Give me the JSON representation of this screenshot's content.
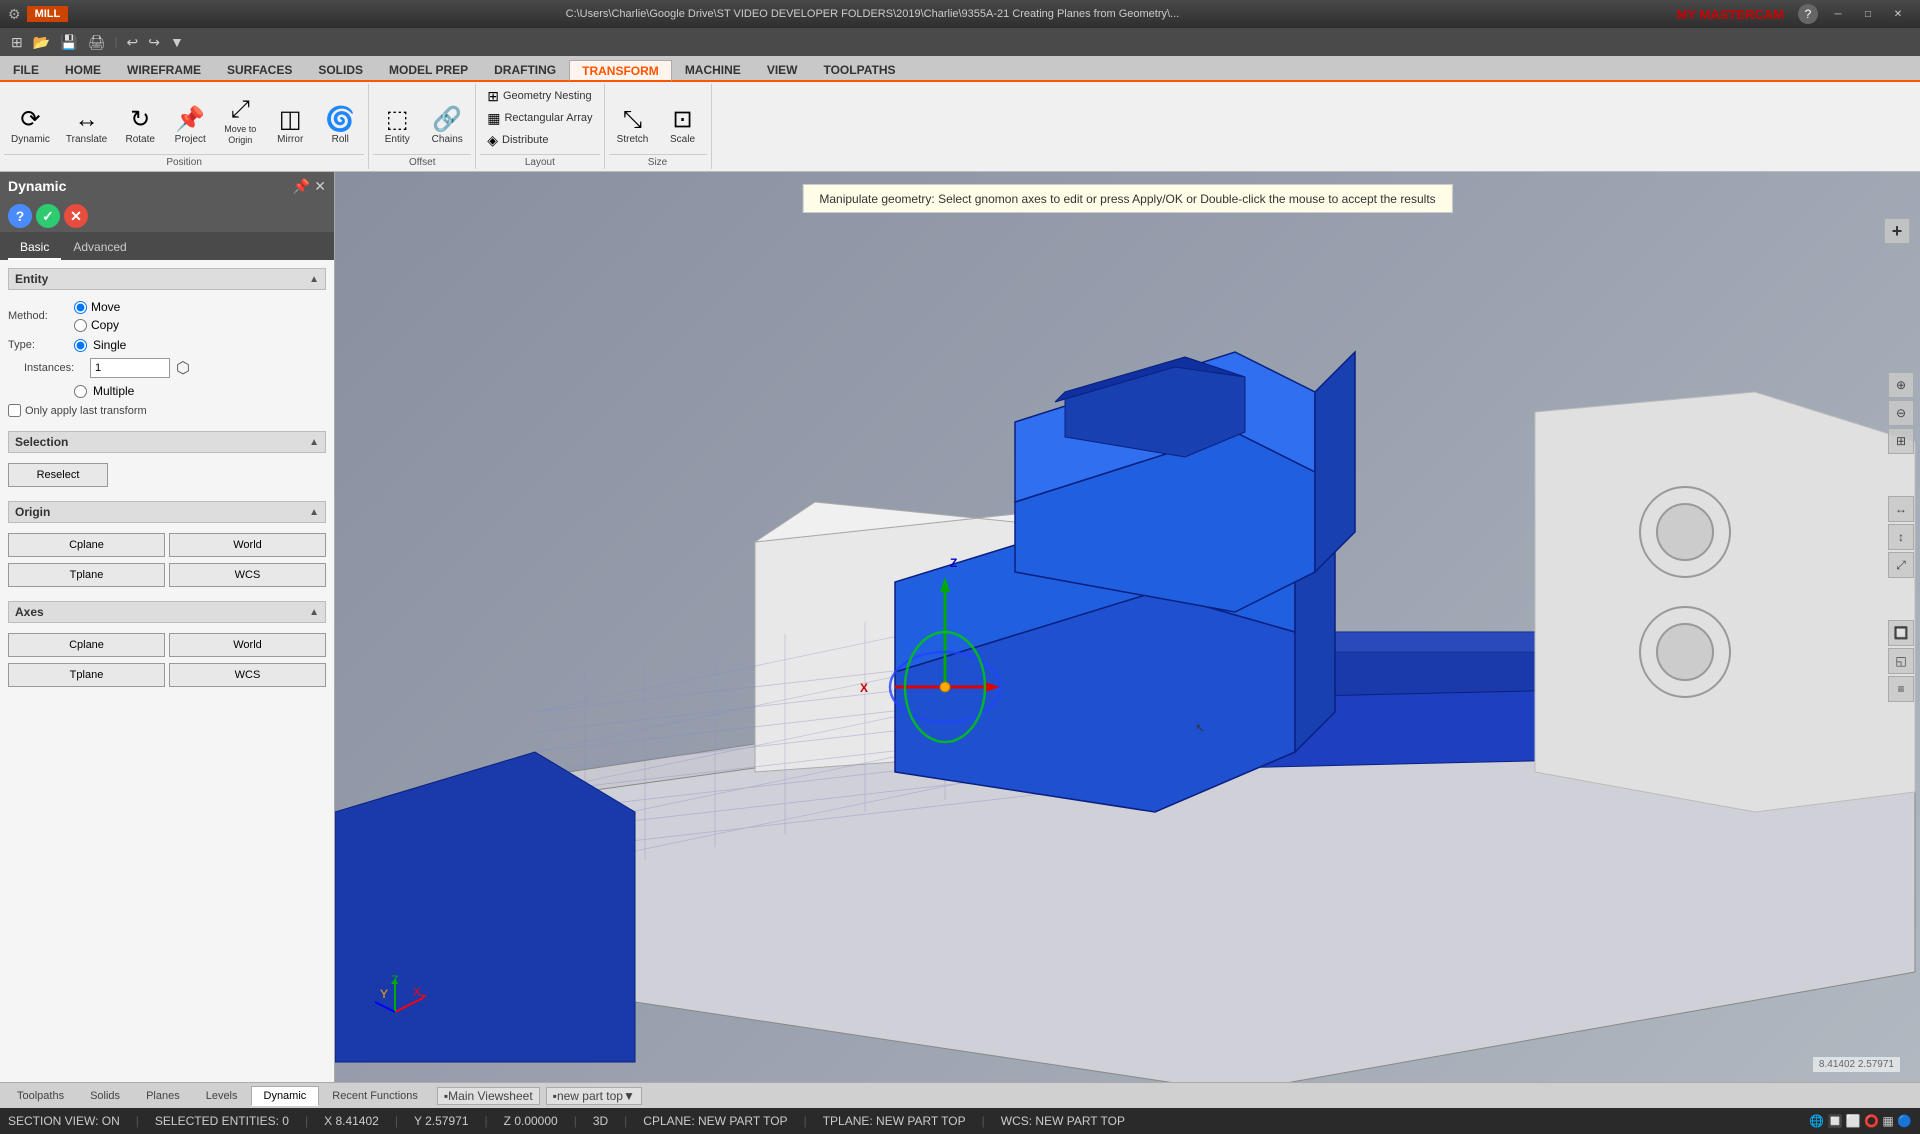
{
  "app": {
    "name": "Mastercam",
    "mill_label": "MILL",
    "title": "C:\\Users\\Charlie\\Google Drive\\ST VIDEO DEVELOPER FOLDERS\\2019\\Charlie\\9355A-21 Creating Planes from Geometry\\...",
    "branding": "MY MASTERCAM"
  },
  "quickaccess": {
    "buttons": [
      "⊞",
      "📁",
      "💾",
      "🖨",
      "↩",
      "↪",
      "▼"
    ]
  },
  "ribbon_tabs": {
    "items": [
      {
        "label": "FILE",
        "active": false
      },
      {
        "label": "HOME",
        "active": false
      },
      {
        "label": "WIREFRAME",
        "active": false
      },
      {
        "label": "SURFACES",
        "active": false
      },
      {
        "label": "SOLIDS",
        "active": false
      },
      {
        "label": "MODEL PREP",
        "active": false
      },
      {
        "label": "DRAFTING",
        "active": false
      },
      {
        "label": "TRANSFORM",
        "active": true
      },
      {
        "label": "MACHINE",
        "active": false
      },
      {
        "label": "VIEW",
        "active": false
      },
      {
        "label": "TOOLPATHS",
        "active": false
      }
    ]
  },
  "ribbon_groups": {
    "position": {
      "label": "Position",
      "buttons": [
        {
          "icon": "⟳",
          "label": "Dynamic"
        },
        {
          "icon": "↔",
          "label": "Translate"
        },
        {
          "icon": "↻",
          "label": "Rotate"
        },
        {
          "icon": "📌",
          "label": "Project"
        },
        {
          "icon": "⤢",
          "label": "Move to\nOrigin"
        },
        {
          "icon": "🔄",
          "label": "Mirror"
        },
        {
          "icon": "🌀",
          "label": "Roll"
        }
      ]
    },
    "offset": {
      "label": "Offset",
      "buttons": [
        {
          "icon": "⬚",
          "label": "Entity"
        },
        {
          "icon": "🔗",
          "label": "Chains"
        }
      ]
    },
    "layout": {
      "label": "Layout",
      "items": [
        {
          "icon": "⊞",
          "label": "Geometry Nesting"
        },
        {
          "icon": "▦",
          "label": "Rectangular Array"
        },
        {
          "icon": "◈",
          "label": "Distribute"
        }
      ]
    },
    "size": {
      "label": "Size",
      "buttons": [
        {
          "icon": "⤡",
          "label": "Stretch"
        },
        {
          "icon": "⊡",
          "label": "Scale"
        }
      ]
    }
  },
  "panel": {
    "title": "Dynamic",
    "pin_icon": "📌",
    "close_icon": "✕",
    "action_buttons": [
      {
        "icon": "?",
        "type": "blue"
      },
      {
        "icon": "✓",
        "type": "green"
      },
      {
        "icon": "✕",
        "type": "red"
      }
    ],
    "tabs": [
      {
        "label": "Basic",
        "active": true
      },
      {
        "label": "Advanced",
        "active": false
      }
    ],
    "sections": {
      "entity": {
        "title": "Entity",
        "method_label": "Method:",
        "method_options": [
          {
            "label": "Move",
            "value": "move",
            "checked": true
          },
          {
            "label": "Copy",
            "value": "copy",
            "checked": false
          }
        ],
        "type_label": "Type:",
        "type_single_label": "Single",
        "type_single_checked": true,
        "instances_label": "Instances:",
        "instances_value": "1",
        "type_multiple_label": "Multiple",
        "type_multiple_checked": false,
        "checkbox_label": "Only apply last transform",
        "checkbox_checked": false
      },
      "selection": {
        "title": "Selection",
        "reselect_label": "Reselect"
      },
      "origin": {
        "title": "Origin",
        "buttons": [
          [
            "Cplane",
            "World"
          ],
          [
            "Tplane",
            "WCS"
          ]
        ]
      },
      "axes": {
        "title": "Axes",
        "buttons": [
          [
            "Cplane",
            "World"
          ],
          [
            "Tplane",
            "WCS"
          ]
        ]
      }
    }
  },
  "viewport": {
    "hint": "Manipulate geometry: Select gnomon axes to edit or press Apply/OK or Double-click the mouse to accept the results"
  },
  "bottom_tabs": {
    "items": [
      {
        "label": "Toolpaths",
        "active": false
      },
      {
        "label": "Solids",
        "active": false
      },
      {
        "label": "Planes",
        "active": false
      },
      {
        "label": "Levels",
        "active": false
      },
      {
        "label": "Dynamic",
        "active": true
      },
      {
        "label": "Recent Functions",
        "active": false
      }
    ],
    "viewport_btn": "Main Viewsheet",
    "part_btn": "new part top",
    "expand_btn": "▼"
  },
  "status_bar": {
    "section_view": "SECTION VIEW: ON",
    "selected": "SELECTED ENTITIES: 0",
    "x_label": "X",
    "x_value": "8.41402",
    "y_label": "Y",
    "y_value": "2.57971",
    "z_label": "Z",
    "z_value": "0.00000",
    "mode": "3D",
    "cplane": "CPLANE: NEW PART TOP",
    "tplane": "TPLANE: NEW PART TOP",
    "wcs": "WCS: NEW PART TOP"
  }
}
